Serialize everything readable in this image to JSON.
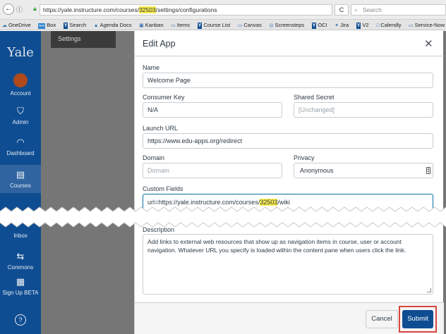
{
  "browser": {
    "back": "←",
    "site_info": "ⓘ",
    "url_prefix": "https://yale.instructure.com/courses/",
    "url_highlight": "32503",
    "url_suffix": "/settings/configurations",
    "reload": "C",
    "search_placeholder": "Search",
    "bookmarks": [
      {
        "icon": "cloud",
        "label": "OneDrive"
      },
      {
        "icon": "box",
        "label": "Box"
      },
      {
        "icon": "Y",
        "label": "Search"
      },
      {
        "icon": "doc",
        "label": "Agenda Docs"
      },
      {
        "icon": "kanban",
        "label": "Kanban"
      },
      {
        "icon": "folder",
        "label": "Items"
      },
      {
        "icon": "Y",
        "label": "Course List"
      },
      {
        "icon": "folder",
        "label": "Canvas"
      },
      {
        "icon": "camera",
        "label": "Screensteps"
      },
      {
        "icon": "Y",
        "label": "OCI"
      },
      {
        "icon": "jira",
        "label": "Jira"
      },
      {
        "icon": "Y",
        "label": "V2"
      },
      {
        "icon": "page",
        "label": "Calendly"
      },
      {
        "icon": "folder",
        "label": "Service-Now"
      }
    ]
  },
  "global_nav": {
    "logo": "Yale",
    "items": [
      {
        "label": "Account",
        "icon": "avatar-icon"
      },
      {
        "label": "Admin",
        "icon": "shield-icon"
      },
      {
        "label": "Dashboard",
        "icon": "gauge-icon"
      },
      {
        "label": "Courses",
        "icon": "book-icon"
      },
      {
        "label": "Inbox",
        "icon": "inbox-icon"
      },
      {
        "label": "Commons",
        "icon": "commons-icon"
      },
      {
        "label": "Sign Up BETA",
        "icon": "calendar-clock-icon"
      },
      {
        "label": "",
        "icon": "help-icon"
      }
    ]
  },
  "settings_tab": "Settings",
  "modal": {
    "title": "Edit App",
    "close": "✕",
    "fields": {
      "name": {
        "label": "Name",
        "value": "Welcome Page"
      },
      "consumer_key": {
        "label": "Consumer Key",
        "value": "N/A"
      },
      "shared_secret": {
        "label": "Shared Secret",
        "placeholder": "[Unchanged]"
      },
      "launch_url": {
        "label": "Launch URL",
        "value": "https://www.edu-apps.org/redirect"
      },
      "domain": {
        "label": "Domain",
        "placeholder": "Domain"
      },
      "privacy": {
        "label": "Privacy",
        "value": "Anonymous"
      },
      "custom_fields": {
        "label": "Custom Fields",
        "value_prefix": "url=https://yale.instructure.com/courses/",
        "value_highlight": "32503",
        "value_suffix": "/wiki"
      },
      "description": {
        "label": "Description",
        "value": "Add links to external web resources that show up as navigation items in course, user or account navigation. Whatever URL you specify is loaded within the content pane when users click the link."
      }
    },
    "cancel": "Cancel",
    "submit": "Submit"
  },
  "colors": {
    "brand": "#0f4d92",
    "highlight": "#f7ec4f",
    "annotation": "#d9453f"
  }
}
